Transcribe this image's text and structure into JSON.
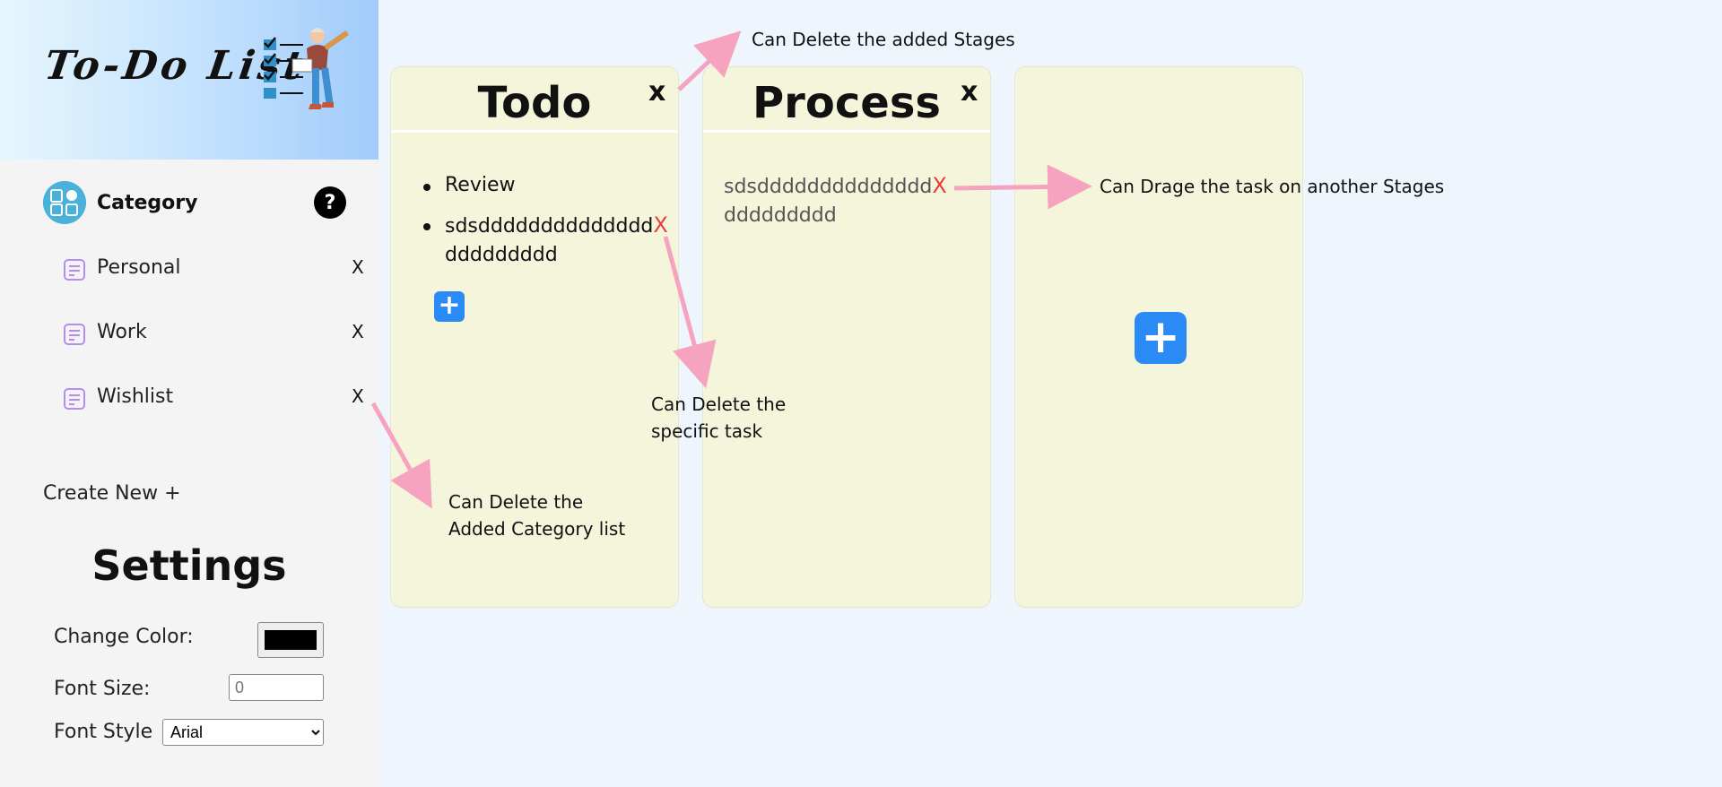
{
  "app": {
    "logo_text": "To-Do List"
  },
  "sidebar": {
    "category_title": "Category",
    "help_label": "?",
    "categories": [
      {
        "label": "Personal",
        "delete_label": "X"
      },
      {
        "label": "Work",
        "delete_label": "X"
      },
      {
        "label": "Wishlist",
        "delete_label": "X"
      }
    ],
    "create_new_label": "Create New +"
  },
  "settings": {
    "title": "Settings",
    "change_color_label": "Change Color:",
    "color_value": "#000000",
    "font_size_label": "Font Size:",
    "font_size_placeholder": "0",
    "font_style_label": "Font Style",
    "font_style_selected": "Arial"
  },
  "stages": [
    {
      "title": "Todo",
      "delete_label": "x",
      "tasks": [
        {
          "text": "Review"
        },
        {
          "text_line1": "sdsdddddddddddddd",
          "text_line2": "ddddddddd",
          "delete_label": "X"
        }
      ],
      "add_task_label": "+"
    },
    {
      "title": "Process",
      "delete_label": "x",
      "tasks": [
        {
          "text_line1": "sdsdddddddddddddd",
          "text_line2": "ddddddddd",
          "delete_label": "X"
        }
      ]
    },
    {
      "title": "",
      "add_stage_label": "+"
    }
  ],
  "annotations": {
    "delete_stages": "Can Delete the added Stages",
    "drag_task": "Can Drage the task on another Stages",
    "delete_task_line1": "Can Delete the",
    "delete_task_line2": "specific task",
    "delete_category_line1": "Can Delete the",
    "delete_category_line2": "Added Category list"
  },
  "colors": {
    "accent": "#2a8af6",
    "stage_bg": "#f5f5dc",
    "task_delete": "#e83b3b",
    "annotation_arrow": "#f6a3c0",
    "category_icon": "#4ab1db"
  }
}
